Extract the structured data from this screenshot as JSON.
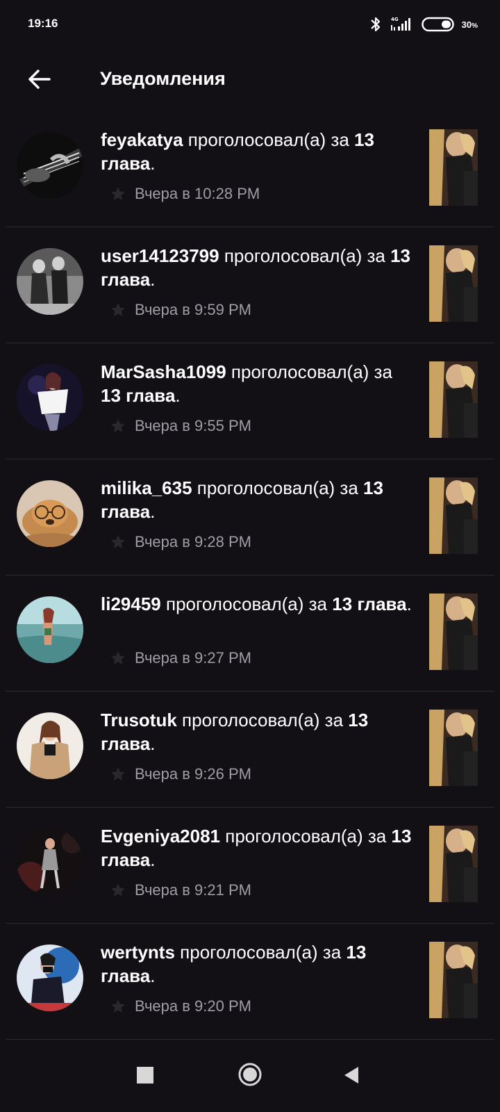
{
  "status_bar": {
    "time": "19:16",
    "battery": "30",
    "battery_unit": "%",
    "network": "4G",
    "icons": [
      "bluetooth-icon",
      "signal-icon",
      "battery-icon"
    ]
  },
  "app_bar": {
    "title": "Уведомления",
    "back_icon": "arrow-left-icon"
  },
  "action_text": "проголосовал(а) за",
  "notifications": [
    {
      "username": "feyakatya",
      "chapter": "13 глава",
      "time": "Вчера в 10:28 PM",
      "avatar_palette": [
        "#222",
        "#ddd"
      ]
    },
    {
      "username": "user14123799",
      "chapter": "13 глава",
      "time": "Вчера в 9:59 PM",
      "avatar_palette": [
        "#666",
        "#ccc"
      ]
    },
    {
      "username": "MarSasha1099",
      "chapter": "13 глава",
      "time": "Вчера в 9:55 PM",
      "avatar_palette": [
        "#1b1830",
        "#f2f2f2"
      ]
    },
    {
      "username": "milika_635",
      "chapter": "13 глава",
      "time": "Вчера в 9:28 PM",
      "avatar_palette": [
        "#c9a07a",
        "#8a5a30"
      ]
    },
    {
      "username": "li29459",
      "chapter": "13 глава",
      "time": "Вчера в 9:27 PM",
      "avatar_palette": [
        "#a7cfd6",
        "#4f8c90"
      ]
    },
    {
      "username": "Trusotuk",
      "chapter": "13 глава",
      "time": "Вчера в 9:26 PM",
      "avatar_palette": [
        "#efe7e0",
        "#b3875a"
      ]
    },
    {
      "username": "Evgeniya2081",
      "chapter": "13 глава",
      "time": "Вчера в 9:21 PM",
      "avatar_palette": [
        "#1a1416",
        "#7a2a2a"
      ]
    },
    {
      "username": "wertynts",
      "chapter": "13 глава",
      "time": "Вчера в 9:20 PM",
      "avatar_palette": [
        "#2c6bb5",
        "#e6e6e6"
      ]
    }
  ],
  "colors": {
    "background": "#121014",
    "divider": "#2c2a2f",
    "secondary_text": "#a09ea5"
  },
  "nav_bar": {
    "buttons": [
      "recents-square-icon",
      "home-circle-icon",
      "back-triangle-icon"
    ]
  }
}
